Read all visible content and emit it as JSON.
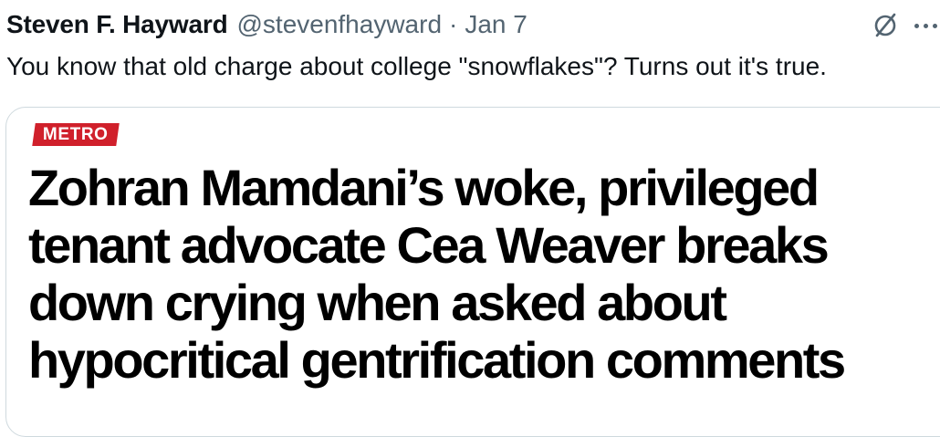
{
  "tweet": {
    "author_name": "Steven F. Hayward",
    "author_handle": "@stevenfhayward",
    "separator": "·",
    "date": "Jan 7",
    "text": "You know that old charge about college \"snowflakes\"? Turns out it's true."
  },
  "icons": {
    "grok": "grok-slash-circle-icon",
    "more": "more-horizontal-icon"
  },
  "card": {
    "section_tag": "METRO",
    "headline_lines": [
      "Zohran Mamdani’s woke, privileged",
      "tenant advocate Cea Weaver breaks",
      "down crying when asked about",
      "hypocritical gentrification comments"
    ]
  },
  "colors": {
    "text_primary": "#0f1419",
    "text_secondary": "#536471",
    "border": "#cfd9de",
    "section_tag_bg": "#d0202b"
  }
}
